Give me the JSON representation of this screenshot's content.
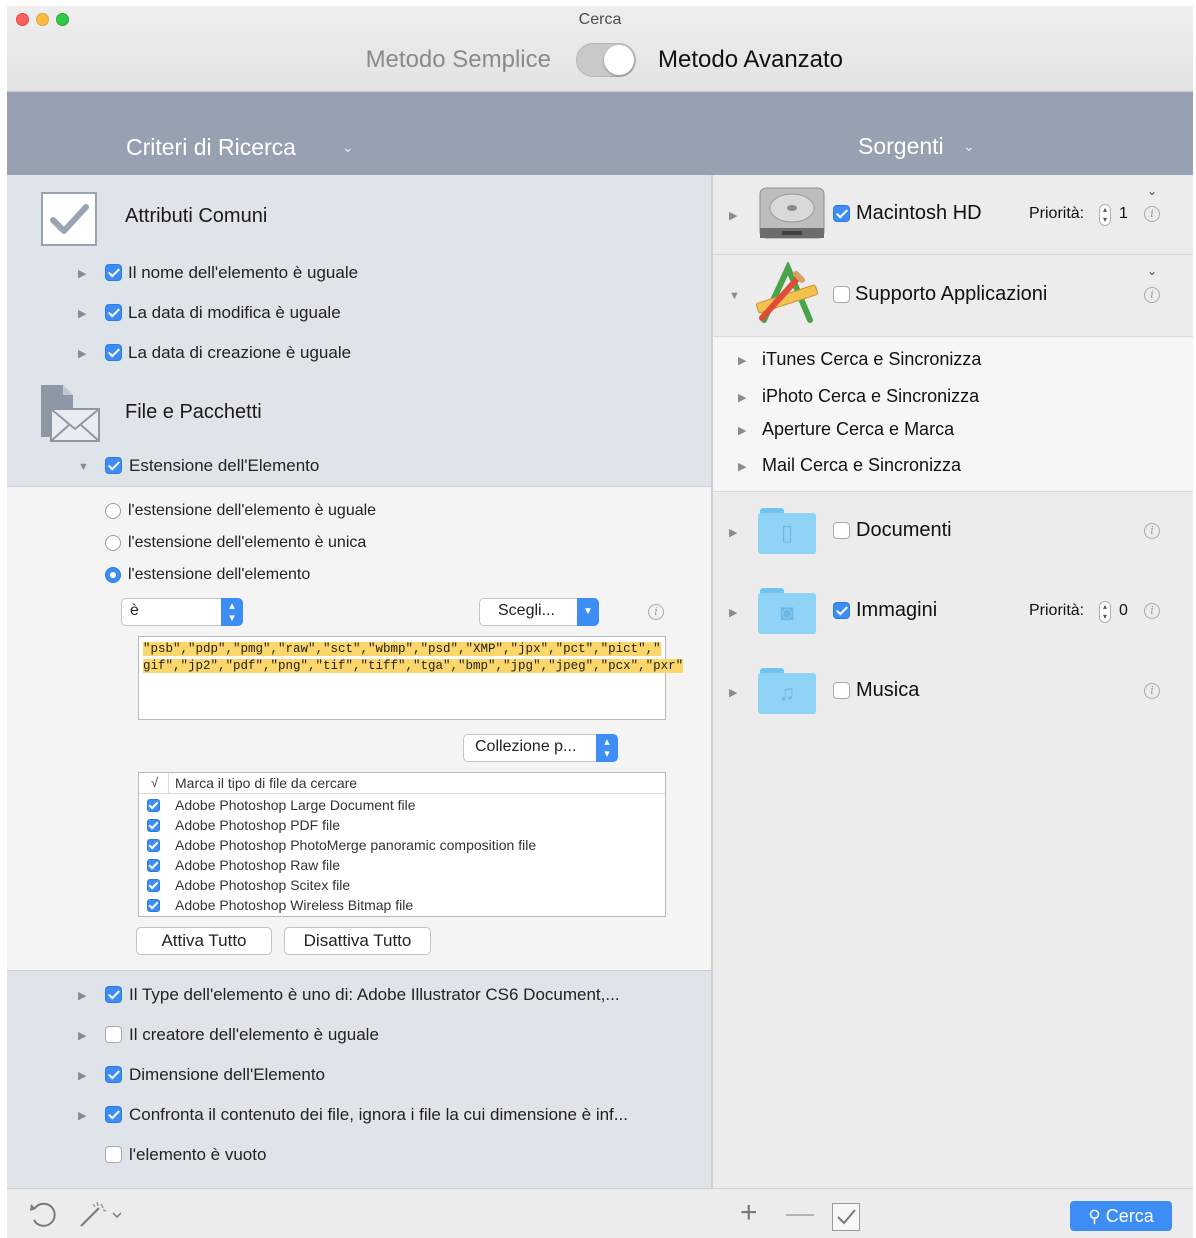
{
  "window": {
    "title": "Cerca"
  },
  "mode": {
    "simple": "Metodo Semplice",
    "advanced": "Metodo Avanzato"
  },
  "columns": {
    "left": "Criteri di Ricerca",
    "right": "Sorgenti"
  },
  "criteria": {
    "common_title": "Attributi Comuni",
    "common_items": [
      {
        "label": "Il nome dell'elemento è uguale",
        "checked": true
      },
      {
        "label": "La data di modifica è uguale",
        "checked": true
      },
      {
        "label": "La data di creazione è uguale",
        "checked": true
      }
    ],
    "files_title": "File e Pacchetti",
    "extension_label": "Estensione dell'Elemento",
    "radios": [
      {
        "label": "l'estensione dell'elemento è uguale",
        "selected": false
      },
      {
        "label": "l'estensione dell'elemento è unica",
        "selected": false
      },
      {
        "label": "l'estensione dell'elemento",
        "selected": true
      }
    ],
    "operator_value": "è",
    "choose_label": "Scegli...",
    "extensions_line1": "\"psb\",\"pdp\",\"pmg\",\"raw\",\"sct\",\"wbmp\",\"psd\",\"XMP\",\"jpx\",\"pct\",\"pict\",\"",
    "extensions_line2": "gif\",\"jp2\",\"pdf\",\"png\",\"tif\",\"tiff\",\"tga\",\"bmp\",\"jpg\",\"jpeg\",\"pcx\",\"pxr\"",
    "collection_label": "Collezione p...",
    "list_check_header": "√",
    "list_header": "Marca il tipo di file da cercare",
    "file_types": [
      "Adobe Photoshop Large Document file",
      "Adobe Photoshop PDF file",
      "Adobe Photoshop PhotoMerge panoramic composition file",
      "Adobe Photoshop Raw file",
      "Adobe Photoshop Scitex file",
      "Adobe Photoshop Wireless Bitmap file"
    ],
    "enable_all": "Attiva Tutto",
    "disable_all": "Disattiva Tutto",
    "more_items": [
      {
        "label": "Il Type dell'elemento è uno di: Adobe Illustrator CS6 Document,...",
        "checked": true
      },
      {
        "label": "Il creatore dell'elemento è uguale",
        "checked": false
      },
      {
        "label": "Dimensione dell'Elemento",
        "checked": true
      },
      {
        "label": "Confronta il contenuto dei file, ignora i file la cui dimensione è inf...",
        "checked": true
      },
      {
        "label": "l'elemento è vuoto",
        "checked": false
      }
    ]
  },
  "sources": {
    "macintosh": {
      "label": "Macintosh HD",
      "checked": true,
      "priority_label": "Priorità:",
      "priority": "1"
    },
    "app_support": {
      "label": "Supporto Applicazioni",
      "checked": false
    },
    "app_sub": [
      "iTunes Cerca e Sincronizza",
      "iPhoto Cerca e Sincronizza",
      "Aperture Cerca e Marca",
      "Mail Cerca e Sincronizza"
    ],
    "documents": {
      "label": "Documenti",
      "checked": false
    },
    "images": {
      "label": "Immagini",
      "checked": true,
      "priority_label": "Priorità:",
      "priority": "0"
    },
    "music": {
      "label": "Musica",
      "checked": false
    }
  },
  "bottom": {
    "search_label": "Cerca"
  },
  "colors": {
    "accent": "#3d8df5",
    "header_band": "#97a1b1",
    "highlight": "#fbd66a",
    "folder": "#8fd3f7"
  }
}
